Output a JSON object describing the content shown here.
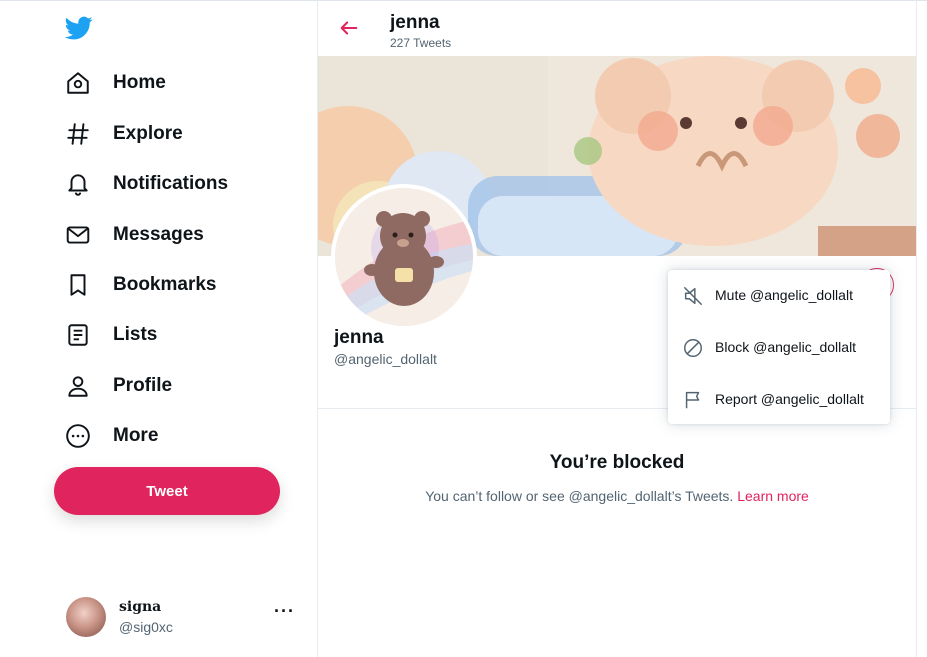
{
  "sidebar": {
    "logo_icon": "twitter-bird-icon",
    "items": [
      {
        "label": "Home",
        "icon": "home-icon"
      },
      {
        "label": "Explore",
        "icon": "hashtag-icon"
      },
      {
        "label": "Notifications",
        "icon": "bell-icon"
      },
      {
        "label": "Messages",
        "icon": "envelope-icon"
      },
      {
        "label": "Bookmarks",
        "icon": "bookmark-icon"
      },
      {
        "label": "Lists",
        "icon": "list-icon"
      },
      {
        "label": "Profile",
        "icon": "person-icon"
      },
      {
        "label": "More",
        "icon": "more-circle-icon"
      }
    ],
    "tweet_label": "Tweet",
    "account": {
      "name": "𝐬𝐢𝐠𝐧𝐚",
      "handle": "@sig0xc",
      "more": "···"
    }
  },
  "header": {
    "name": "jenna",
    "tweets_count": "227 Tweets"
  },
  "profile": {
    "name": "jenna",
    "handle": "@angelic_dollalt"
  },
  "blocked": {
    "title": "You’re blocked",
    "message": "You can’t follow or see @angelic_dollalt’s Tweets.",
    "link": "Learn more"
  },
  "dropdown": {
    "items": [
      {
        "label": "Mute @angelic_dollalt",
        "icon": "mute-icon"
      },
      {
        "label": "Block @angelic_dollalt",
        "icon": "block-icon"
      },
      {
        "label": "Report @angelic_dollalt",
        "icon": "flag-icon"
      }
    ]
  },
  "colors": {
    "accent": "#e0245e",
    "brand_blue": "#1da1f2",
    "text": "#0f1419",
    "secondary": "#536471"
  }
}
